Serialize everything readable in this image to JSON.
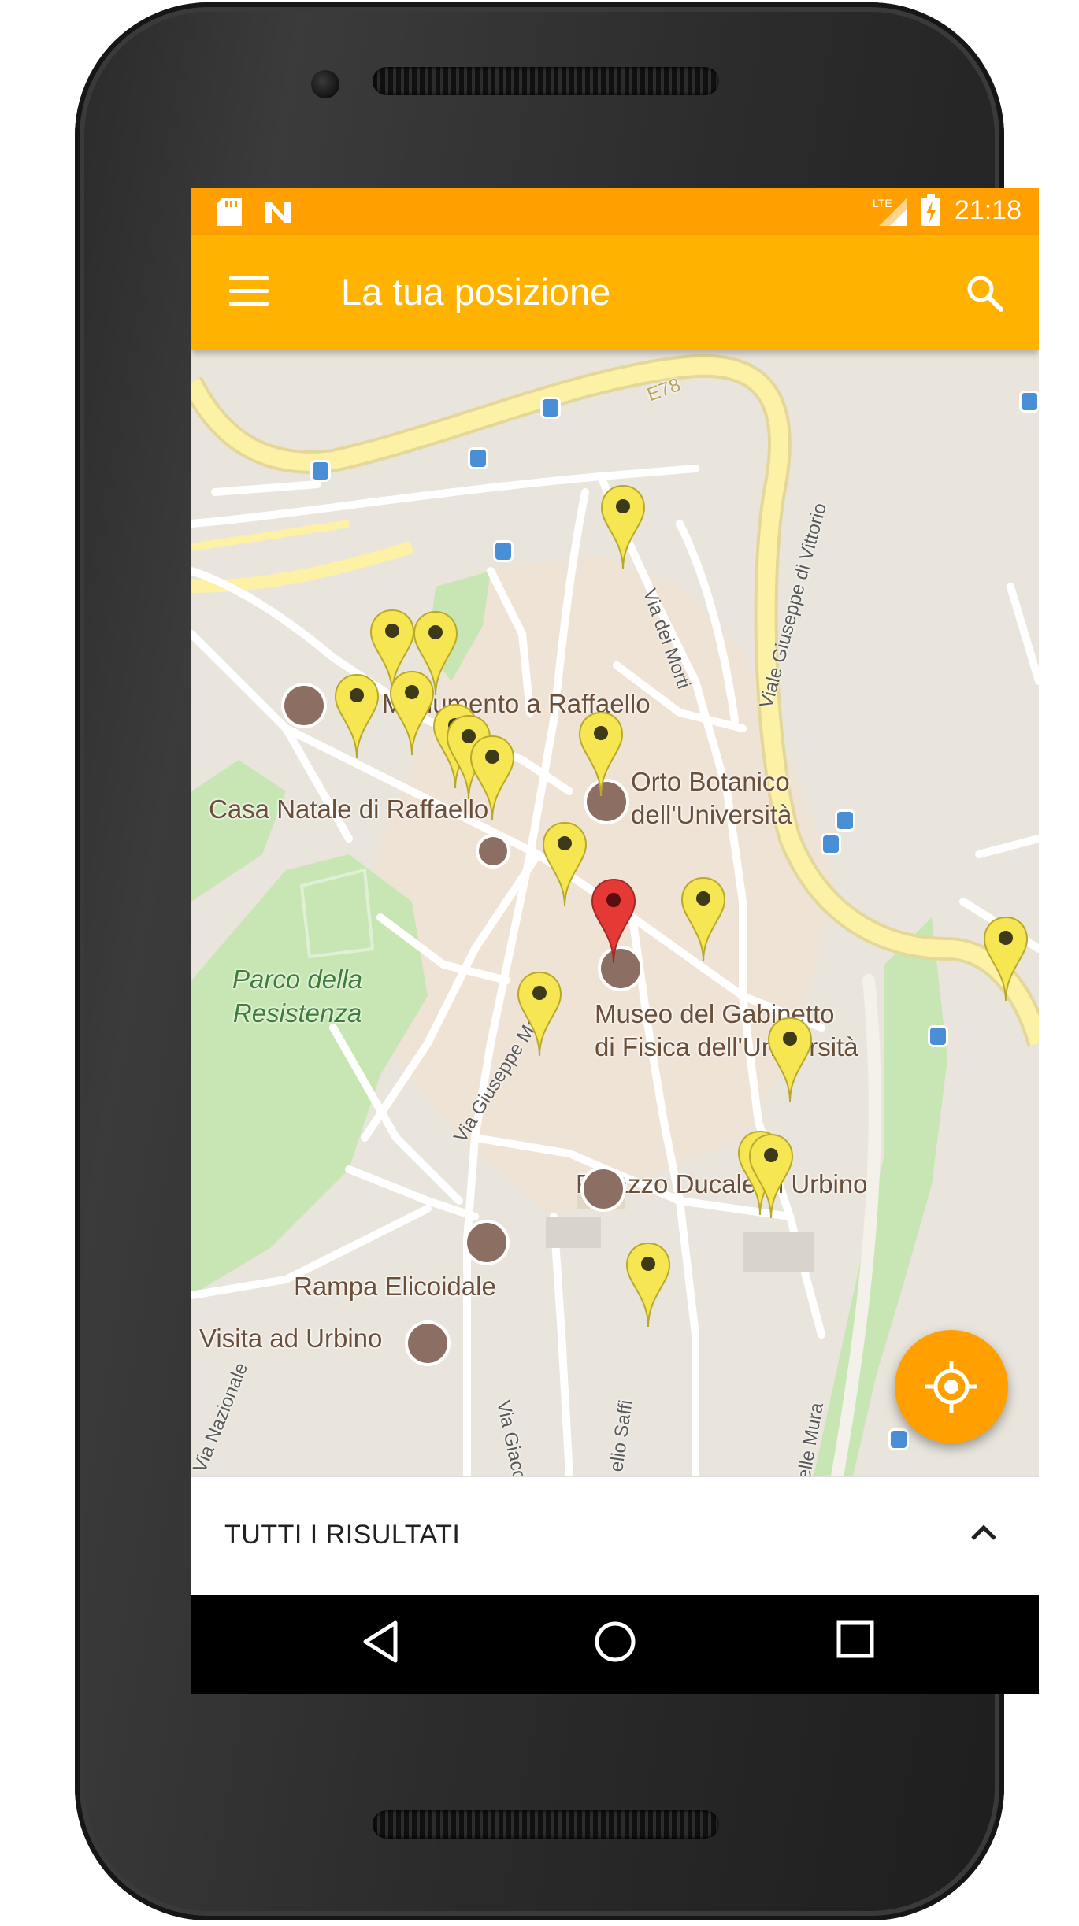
{
  "status_bar": {
    "time": "21:18",
    "network": "LTE",
    "icons": [
      "sd-card-icon",
      "n-notification-icon",
      "lte-signal-icon",
      "battery-charging-icon"
    ]
  },
  "app_bar": {
    "title": "La tua posizione",
    "menu_icon": "hamburger-menu-icon",
    "search_icon": "search-icon"
  },
  "map": {
    "places": {
      "monumento": "Monumento a Raffaello",
      "casa_natale": "Casa Natale di Raffaello",
      "orto_line1": "Orto Botanico",
      "orto_line2": "dell'Università",
      "museo_line1": "Museo del Gabinetto",
      "museo_line2": "di Fisica dell'Università",
      "palazzo": "Palazzo Ducale di Urbino",
      "rampa": "Rampa Elicoidale",
      "visita": "Visita ad Urbino"
    },
    "park": {
      "line1": "Parco della",
      "line2": "Resistenza"
    },
    "streets": {
      "morti": "Via dei Morti",
      "vittorio": "Viale Giuseppe di Vittorio",
      "mazzini": "Via Giuseppe Mazzini",
      "nazionale": "Via Nazionale",
      "giacomo": "Via Giaco",
      "saffi": "elio Saffi",
      "mura": "elle Mura",
      "e78": "E78"
    },
    "colors": {
      "map_base": "#e9e5dc",
      "park": "#c8e6b4",
      "highway": "#fdf1a6",
      "pin_yellow": "#f6e652",
      "pin_red": "#e53935"
    },
    "marker_count": 20
  },
  "fab": {
    "icon": "my-location-icon",
    "color": "#ffa000"
  },
  "bottom_sheet": {
    "label": "TUTTI I RISULTATI",
    "icon": "chevron-up-icon"
  },
  "nav_bar": {
    "buttons": [
      "back-icon",
      "home-icon",
      "recents-icon"
    ]
  }
}
